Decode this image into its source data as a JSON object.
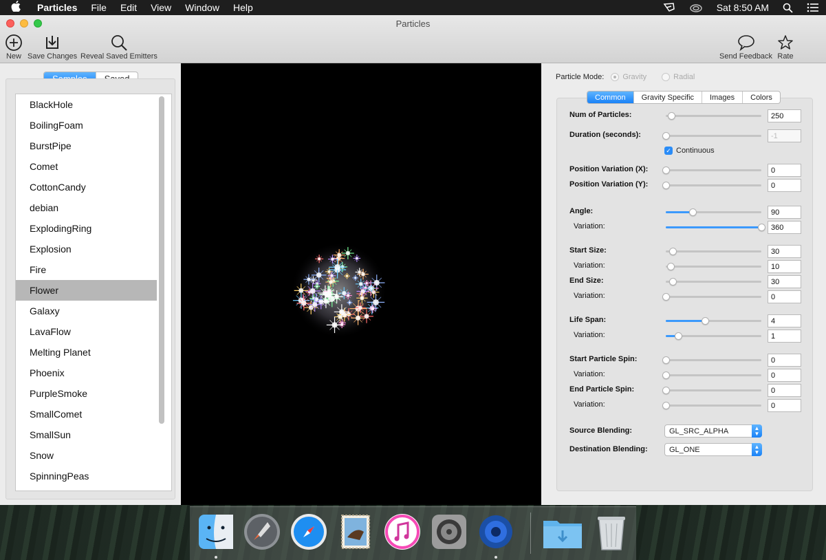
{
  "menubar": {
    "app": "Particles",
    "items": [
      "File",
      "Edit",
      "View",
      "Window",
      "Help"
    ],
    "clock": "Sat 8:50 AM"
  },
  "window": {
    "title": "Particles",
    "toolbar": {
      "new_label": "New",
      "save_label": "Save Changes",
      "reveal_label": "Reveal Saved Emitters",
      "feedback_label": "Send Feedback",
      "rate_label": "Rate"
    }
  },
  "sidebar": {
    "segments": [
      "Samples",
      "Saved"
    ],
    "active_segment": "Samples",
    "items": [
      "BlackHole",
      "BoilingFoam",
      "BurstPipe",
      "Comet",
      "CottonCandy",
      "debian",
      "ExplodingRing",
      "Explosion",
      "Fire",
      "Flower",
      "Galaxy",
      "LavaFlow",
      "Melting Planet",
      "Phoenix",
      "PurpleSmoke",
      "SmallComet",
      "SmallSun",
      "Snow",
      "SpinningPeas"
    ],
    "selected": "Flower"
  },
  "inspector": {
    "mode_label": "Particle Mode:",
    "mode_gravity": "Gravity",
    "mode_radial": "Radial",
    "tabs": [
      "Common",
      "Gravity Specific",
      "Images",
      "Colors"
    ],
    "active_tab": "Common",
    "num_particles": {
      "label": "Num of Particles:",
      "value": "250",
      "level": 0.06
    },
    "duration": {
      "label": "Duration (seconds):",
      "value": "-1",
      "level": 0.0
    },
    "continuous_label": "Continuous",
    "pos_var_x": {
      "label": "Position Variation (X):",
      "value": "0",
      "level": 0.0
    },
    "pos_var_y": {
      "label": "Position Variation (Y):",
      "value": "0",
      "level": 0.0
    },
    "angle": {
      "label": "Angle:",
      "value": "90",
      "level": 0.28
    },
    "angle_var": {
      "label": "Variation:",
      "value": "360",
      "level": 1.0
    },
    "start_size": {
      "label": "Start Size:",
      "value": "30",
      "level": 0.07
    },
    "start_size_var": {
      "label": "Variation:",
      "value": "10",
      "level": 0.05
    },
    "end_size": {
      "label": "End Size:",
      "value": "30",
      "level": 0.07
    },
    "end_size_var": {
      "label": "Variation:",
      "value": "0",
      "level": 0.0
    },
    "life_span": {
      "label": "Life Span:",
      "value": "4",
      "level": 0.41
    },
    "life_span_var": {
      "label": "Variation:",
      "value": "1",
      "level": 0.13
    },
    "start_spin": {
      "label": "Start Particle Spin:",
      "value": "0",
      "level": 0.0
    },
    "start_spin_var": {
      "label": "Variation:",
      "value": "0",
      "level": 0.0
    },
    "end_spin": {
      "label": "End Particle Spin:",
      "value": "0",
      "level": 0.0
    },
    "end_spin_var": {
      "label": "Variation:",
      "value": "0",
      "level": 0.0
    },
    "source_blending": {
      "label": "Source Blending:",
      "value": "GL_SRC_ALPHA"
    },
    "destination_blending": {
      "label": "Destination Blending:",
      "value": "GL_ONE"
    }
  },
  "colors": {
    "accent": "#1a82f7",
    "selection": "#b7b7b7",
    "preview_bg": "#000000"
  },
  "dock": {
    "apps": [
      "finder-icon",
      "launchpad-icon",
      "safari-icon",
      "mail-icon",
      "itunes-icon",
      "system-preferences-icon",
      "particles-app-icon",
      "downloads-folder-icon",
      "trash-icon"
    ]
  }
}
